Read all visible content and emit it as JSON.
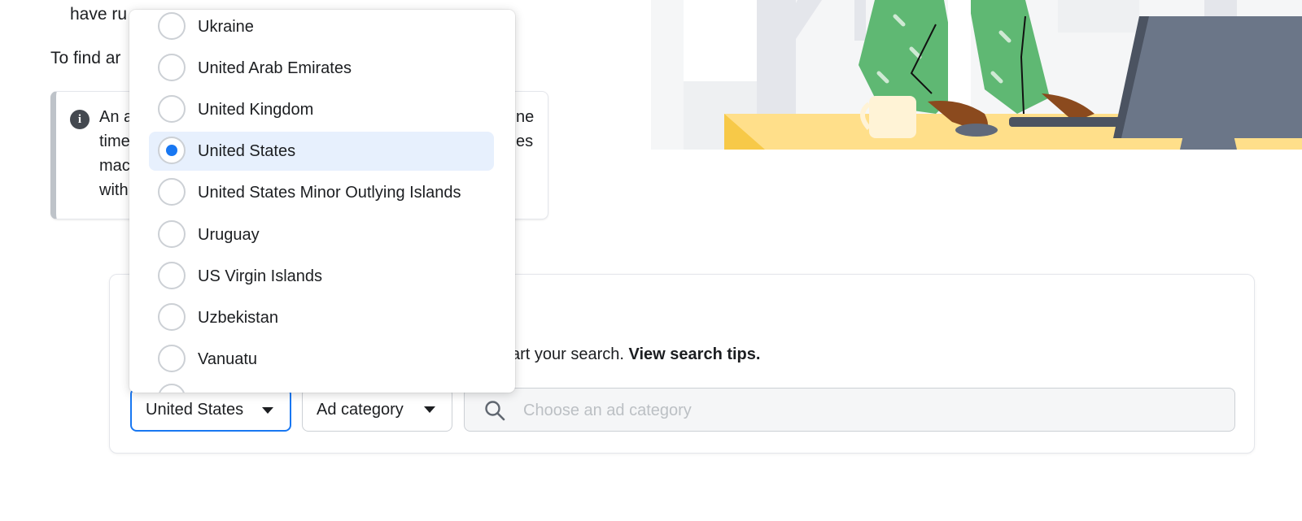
{
  "intro": {
    "line1": "have ru",
    "line2": "To find ar"
  },
  "info": {
    "icon": "info-icon",
    "lines_left": [
      "An a",
      "time",
      "mac",
      "with"
    ],
    "lines_right": [
      "ne",
      "es"
    ]
  },
  "search": {
    "hint_prefix": "art your search.",
    "hint_link": "View search tips.",
    "country_selected": "United States",
    "category_label": "Ad category",
    "placeholder": "Choose an ad category"
  },
  "country_dropdown": {
    "options": [
      {
        "label": "Ukraine",
        "selected": false
      },
      {
        "label": "United Arab Emirates",
        "selected": false
      },
      {
        "label": "United Kingdom",
        "selected": false
      },
      {
        "label": "United States",
        "selected": true
      },
      {
        "label": "United States Minor Outlying Islands",
        "selected": false
      },
      {
        "label": "Uruguay",
        "selected": false
      },
      {
        "label": "US Virgin Islands",
        "selected": false
      },
      {
        "label": "Uzbekistan",
        "selected": false
      },
      {
        "label": "Vanuatu",
        "selected": false
      }
    ]
  },
  "colors": {
    "accent": "#1877f2",
    "selected_bg": "#e7f0fd"
  }
}
